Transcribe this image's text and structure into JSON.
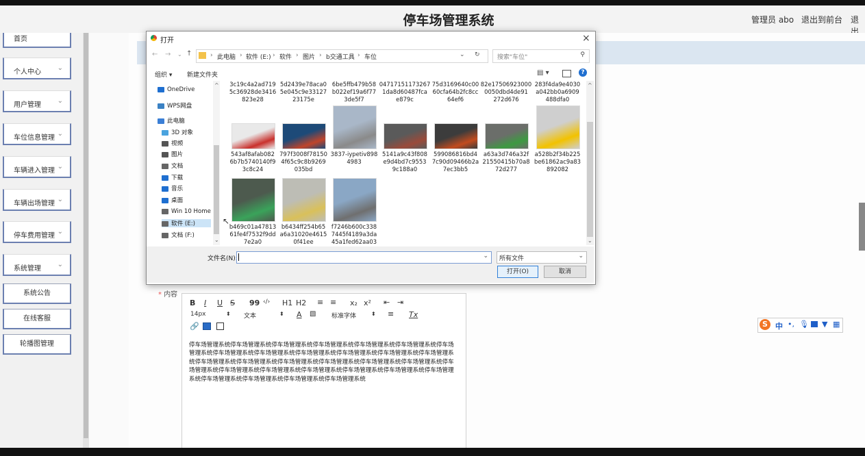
{
  "header": {
    "title": "停车场管理系统",
    "admin_label": "管理员 abo",
    "back_label": "退出到前台",
    "logout_label": "退出"
  },
  "sidebar": {
    "home": "首页",
    "items": [
      {
        "label": "个人中心"
      },
      {
        "label": "用户管理"
      },
      {
        "label": "车位信息管理"
      },
      {
        "label": "车辆进入管理"
      },
      {
        "label": "车辆出场管理"
      },
      {
        "label": "停车费用管理"
      },
      {
        "label": "系统管理"
      }
    ],
    "subitems": [
      {
        "label": "系统公告"
      },
      {
        "label": "在线客服"
      },
      {
        "label": "轮播图管理"
      }
    ]
  },
  "form": {
    "required_mark": "*",
    "content_label": "内容",
    "toolbar": {
      "bold": "B",
      "italic": "I",
      "underline": "U",
      "strike": "S",
      "quote": "99",
      "code": "‹/›",
      "h1": "H1",
      "h2": "H2",
      "ol": "≡",
      "ul": "≡",
      "sub": "x₂",
      "sup": "x²",
      "outdent": "⇤",
      "indent": "⇥",
      "size": "14px",
      "paragraph": "文本",
      "font": "标准字体",
      "color": "A",
      "clean": "Tx"
    },
    "content_text": "停车场管理系统停车场管理系统停车场管理系统停车场管理系统停车场管理系统停车场管理系统停车场管理系统停车场管理系统停车场管理系统停车场管理系统停车场管理系统停车场管理系统停车场管理系统停车场管理系统停车场管理系统停车场管理系统停车场管理系统停车场管理系统停车场管理系统停车场管理系统停车场管理系统停车场管理系统停车场管理系统停车场管理系统停车场管理系统停车场管理系统停车场管理系统停车场管理系统停车场管理系统停车场管理系统"
  },
  "ime": {
    "logo": "S",
    "mode": "中"
  },
  "dialog": {
    "title": "打开",
    "close": "×",
    "path": [
      "此电脑",
      "软件 (E:)",
      "软件",
      "图片",
      "b交通工具",
      "车位"
    ],
    "search_placeholder": "搜索\"车位\"",
    "organize_label": "组织 ▾",
    "newfolder_label": "新建文件夹",
    "nav": [
      {
        "label": "OneDrive",
        "icon": "cloud-icon",
        "color": "#1f6fd0"
      },
      {
        "label": "WPS网盘",
        "icon": "cloud-icon",
        "color": "#3b82c4"
      },
      {
        "label": "此电脑",
        "icon": "computer-icon",
        "color": "#3b7fd6"
      },
      {
        "label": "3D 对象",
        "icon": "cube-icon",
        "color": "#4aa3df"
      },
      {
        "label": "视频",
        "icon": "video-icon",
        "color": "#555555"
      },
      {
        "label": "图片",
        "icon": "picture-icon",
        "color": "#555555"
      },
      {
        "label": "文档",
        "icon": "document-icon",
        "color": "#666666"
      },
      {
        "label": "下载",
        "icon": "download-icon",
        "color": "#1f6fd0"
      },
      {
        "label": "音乐",
        "icon": "music-icon",
        "color": "#1f6fd0"
      },
      {
        "label": "桌面",
        "icon": "desktop-icon",
        "color": "#1f6fd0"
      },
      {
        "label": "Win 10 Home x",
        "icon": "drive-icon",
        "color": "#666666"
      },
      {
        "label": "软件 (E:)",
        "icon": "drive-icon",
        "color": "#666666"
      },
      {
        "label": "文档 (F:)",
        "icon": "drive-icon",
        "color": "#666666"
      }
    ],
    "partial_files": [
      "3c19c4a2ad719\n5c36928de3416\n823e28",
      "5d2439e78aca0\n5e045c9e33127\n23175e",
      "6be5ffb479b58\nb022ef19a6f77\n3de5f7",
      "04717151173267\n1da8d60487fca\ne879c",
      "75d3169640c00\n60cfa64b2fc8cc\n64ef6",
      "82e17506923000\n0050dbd4de91\n272d676",
      "283f4da9e4030\na042bb0a6909\n488dfa0"
    ],
    "files": [
      {
        "name": "543af8afab082\n6b7b5740140f9\n3c8c24",
        "color1": "#e9e9e9",
        "color2": "#c9302c"
      },
      {
        "name": "797f3008f78150\n4f65c9c8b9269\n035bd",
        "color1": "#1d4a78",
        "color2": "#c0442a"
      },
      {
        "name": "3837-iypetiv898\n4983",
        "color1": "#a9b7c8",
        "color2": "#8a8a8a"
      },
      {
        "name": "5141a9c43f808\ne9d4bd7c9553\n9c188a0",
        "color1": "#5a5a5a",
        "color2": "#9a4a3a"
      },
      {
        "name": "599086816bd4\n7c90d09466b2a\n7ec3bb5",
        "color1": "#3c3c3c",
        "color2": "#c24b1e"
      },
      {
        "name": "a63a3d746a32f\n21550415b70a8\n72d277",
        "color1": "#6b6e6a",
        "color2": "#3d9a41"
      },
      {
        "name": "a528b2f34b225\nbe61862ac9a83\n892082",
        "color1": "#cfcfcf",
        "color2": "#f2c200"
      },
      {
        "name": "b469c01a47813\n61fe4f7532f9dd\n7e2a0",
        "color1": "#4d5a4e",
        "color2": "#3aa35a"
      },
      {
        "name": "b6434ff254b65\na6a31020e4615\n0f41ee",
        "color1": "#bdbdb5",
        "color2": "#d9c05a"
      },
      {
        "name": "f7246b600c338\n7445f4189a3da\n45a1fed62aa03\nf",
        "color1": "#8aa7c5",
        "color2": "#6f6f6f"
      }
    ],
    "filename_label": "文件名(N):",
    "filename_value": "",
    "filetype": "所有文件",
    "open_label": "打开(O)",
    "cancel_label": "取消"
  }
}
